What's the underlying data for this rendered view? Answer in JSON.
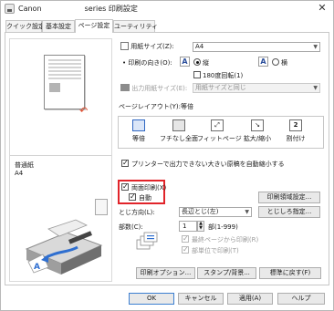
{
  "window": {
    "title_prefix": "Canon",
    "title_suffix": "series 印刷設定",
    "close_glyph": "✕"
  },
  "tabs": [
    {
      "label": "クイック設定",
      "active": false
    },
    {
      "label": "基本設定",
      "active": false
    },
    {
      "label": "ページ設定",
      "active": true
    },
    {
      "label": "ユーティリティ",
      "active": false
    }
  ],
  "preview": {
    "media_line1": "普通紙",
    "media_line2": "A4"
  },
  "page_size": {
    "label": "用紙サイズ(Z):",
    "value": "A4"
  },
  "orientation": {
    "label": "印刷の向き(O):",
    "portrait_label": "縦",
    "landscape_label": "横",
    "portrait_selected": true,
    "rotate_label": "180度回転(1)",
    "icon_glyph": "A"
  },
  "output_size": {
    "label": "出力用紙サイズ(E):",
    "value": "用紙サイズと同じ"
  },
  "page_layout": {
    "label": "ページレイアウト(Y):等倍",
    "items": [
      {
        "label": "等倍",
        "icon": "normal-size-icon",
        "glyph": ""
      },
      {
        "label": "フチなし全面",
        "icon": "borderless-icon",
        "glyph": ""
      },
      {
        "label": "フィットページ",
        "icon": "fit-to-page-icon",
        "glyph": "⤢"
      },
      {
        "label": "拡大/縮小",
        "icon": "scaled-icon",
        "glyph": "↘"
      },
      {
        "label": "割付け",
        "icon": "page-layout-icon",
        "glyph": "2"
      }
    ]
  },
  "auto_reduce": {
    "label": "プリンターで出力できない大きい原稿を自動縮小する",
    "checked": true
  },
  "duplex": {
    "label": "両面印刷(X)",
    "checked": true,
    "auto_label": "自動",
    "auto_checked": true,
    "print_area_button": "印刷領域設定..."
  },
  "binding": {
    "label": "とじ方向(L):",
    "value": "長辺とじ(左)",
    "margin_button": "とじしろ指定..."
  },
  "copies": {
    "label": "部数(C):",
    "value": "1",
    "range": "部(1-999)",
    "last_page_first_label": "最終ページから印刷(R)",
    "collate_label": "部単位で印刷(T)"
  },
  "bottom_buttons": {
    "print_options": "印刷オプション...",
    "stamp_background": "スタンプ/背景...",
    "defaults": "標準に戻す(F)"
  },
  "dialog_buttons": {
    "ok": "OK",
    "cancel": "キャンセル",
    "apply": "適用(A)",
    "help": "ヘルプ"
  },
  "colors": {
    "highlight": "#e1242a",
    "duplex_arrow": "#e04a2a",
    "printer_blue": "#2f6fd0"
  }
}
